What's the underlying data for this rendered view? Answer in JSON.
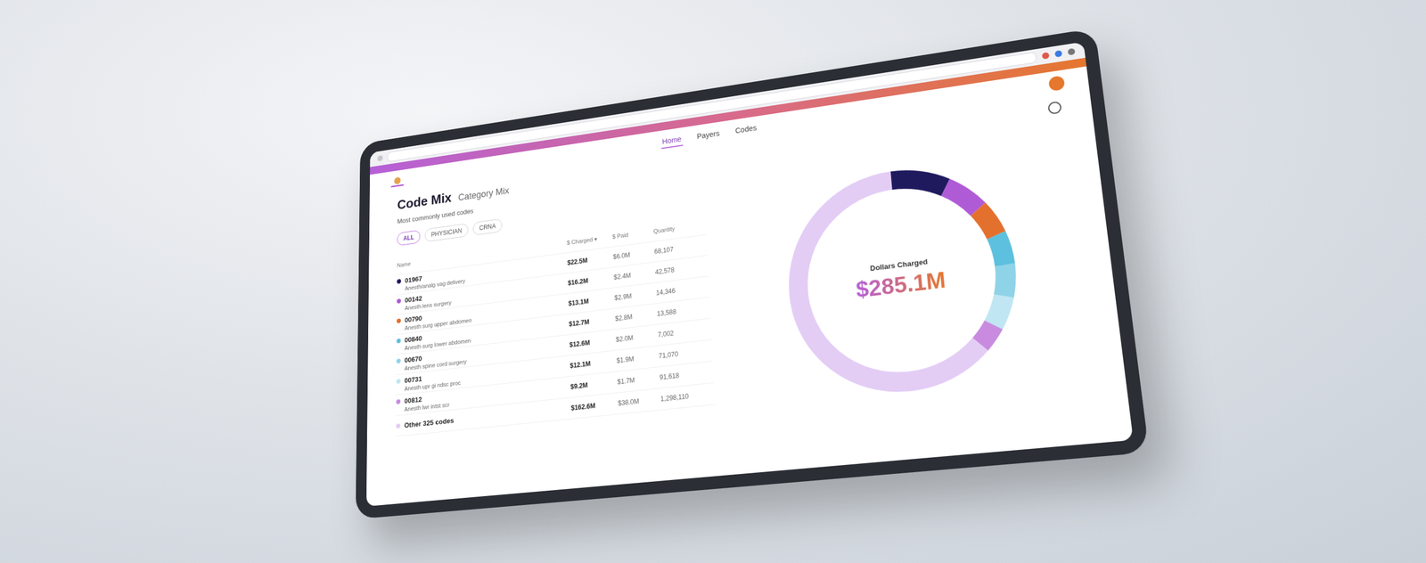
{
  "nav": [
    {
      "label": "Home",
      "selected": true
    },
    {
      "label": "Payers",
      "selected": false
    },
    {
      "label": "Codes",
      "selected": false
    }
  ],
  "page": {
    "title": "Code Mix",
    "subtitle": "Category Mix",
    "description": "Most commonly used codes"
  },
  "filters": [
    {
      "label": "ALL",
      "selected": true
    },
    {
      "label": "PHYSICIAN",
      "selected": false
    },
    {
      "label": "CRNA",
      "selected": false
    }
  ],
  "table": {
    "columns": [
      "Name",
      "$ Charged ▾",
      "$ Paid",
      "Quantity"
    ],
    "rows": [
      {
        "code": "01967",
        "description": "Anesth/analg vag delivery",
        "charged": "$22.5M",
        "paid": "$6.0M",
        "quantity": "68,107",
        "color": "#1f1a5e"
      },
      {
        "code": "00142",
        "description": "Anesth lens surgery",
        "charged": "$16.2M",
        "paid": "$2.4M",
        "quantity": "42,578",
        "color": "#b05bd6"
      },
      {
        "code": "00790",
        "description": "Anesth surg upper abdomen",
        "charged": "$13.1M",
        "paid": "$2.9M",
        "quantity": "14,346",
        "color": "#e4702e"
      },
      {
        "code": "00840",
        "description": "Anesth surg lower abdomen",
        "charged": "$12.7M",
        "paid": "$2.8M",
        "quantity": "13,588",
        "color": "#5cc0de"
      },
      {
        "code": "00670",
        "description": "Anesth spine cord surgery",
        "charged": "$12.6M",
        "paid": "$2.0M",
        "quantity": "7,002",
        "color": "#8fd3e8"
      },
      {
        "code": "00731",
        "description": "Anesth upr gi ndsc proc",
        "charged": "$12.1M",
        "paid": "$1.9M",
        "quantity": "71,070",
        "color": "#bfe6f2"
      },
      {
        "code": "00812",
        "description": "Anesth lwr intst scr",
        "charged": "$9.2M",
        "paid": "$1.7M",
        "quantity": "91,618",
        "color": "#c98be0"
      },
      {
        "code": "Other 325 codes",
        "description": "",
        "charged": "$162.6M",
        "paid": "$38.0M",
        "quantity": "1,298,110",
        "color": "#e3cdf5"
      }
    ]
  },
  "chart": {
    "title": "Dollars Charged",
    "total": "$285.1M",
    "values": [
      22.5,
      16.2,
      13.1,
      12.7,
      12.6,
      12.1,
      9.2,
      162.6
    ]
  }
}
